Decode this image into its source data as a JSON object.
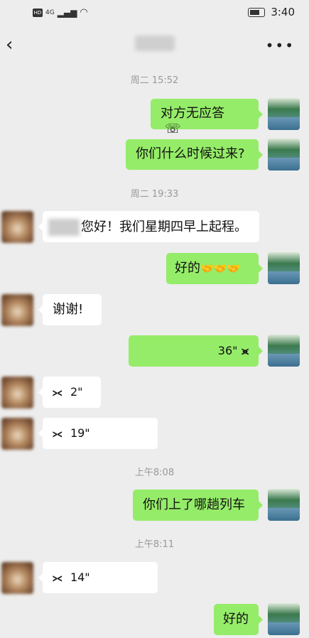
{
  "status_bar": {
    "network": "4G",
    "hd": "HD",
    "time": "3:40"
  },
  "header": {
    "back_icon": "chevron-left-icon",
    "more_icon": "more-dots-icon",
    "more_label": "•••"
  },
  "timestamps": [
    "周二 15:52",
    "周二 19:33",
    "上午8:08",
    "上午8:11"
  ],
  "messages": {
    "m1": {
      "text": "对方无应答",
      "icon": "phone-hangup-icon",
      "icon_glyph": "☏"
    },
    "m2": {
      "text": "你们什么时候过来?"
    },
    "m3": {
      "text": "您好！我们星期四早上起程。"
    },
    "m4": {
      "text": "好的",
      "emoji": "🤝🤝🤝"
    },
    "m5": {
      "text": "谢谢!"
    },
    "m6": {
      "duration": "36\""
    },
    "m7": {
      "duration": "2\""
    },
    "m8": {
      "duration": "19\""
    },
    "m9": {
      "text": "你们上了哪趟列车"
    },
    "m10": {
      "duration": "14\""
    },
    "m11": {
      "text": "好的"
    }
  },
  "colors": {
    "sent_bubble": "#95ec69",
    "received_bubble": "#ffffff",
    "background": "#ededed"
  }
}
